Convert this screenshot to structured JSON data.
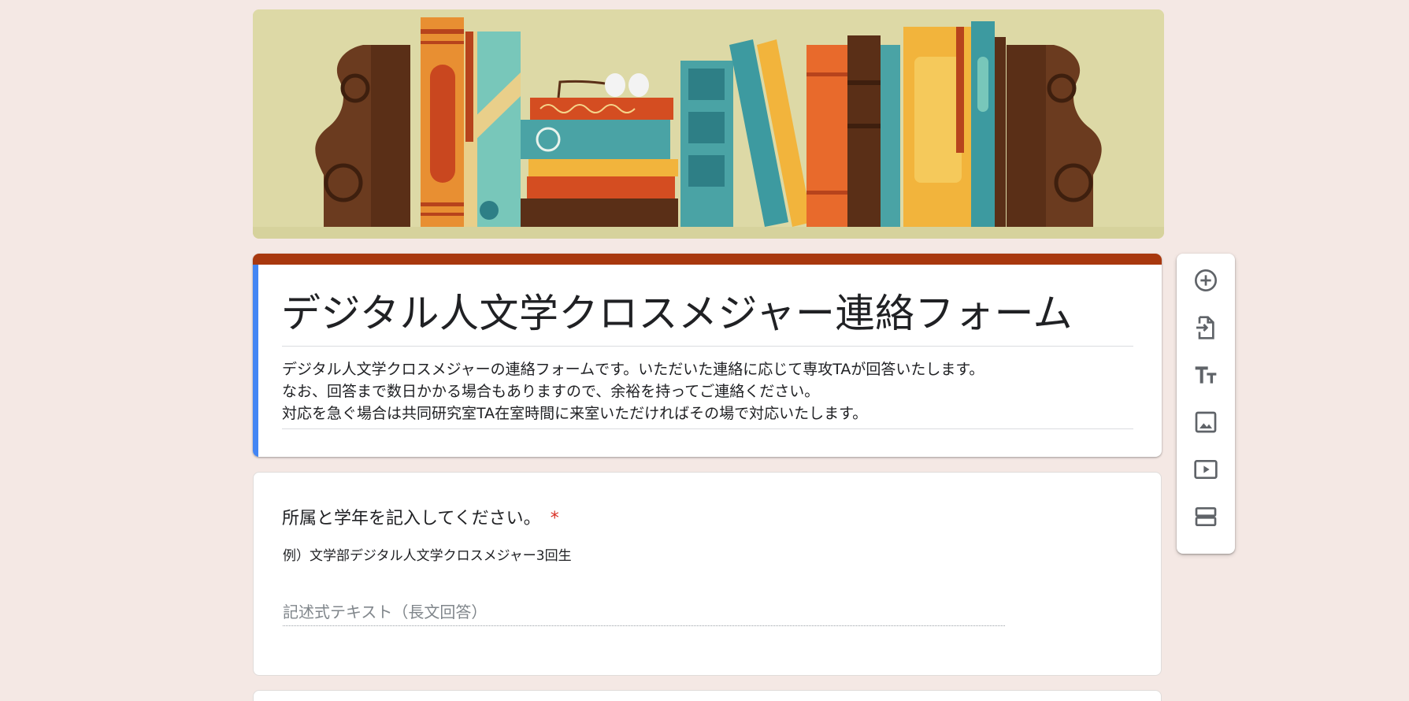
{
  "header": {
    "banner_image": "books-on-shelf-illustration"
  },
  "form": {
    "title": "デジタル人文学クロスメジャー連絡フォーム",
    "description_lines": [
      "デジタル人文学クロスメジャーの連絡フォームです。いただいた連絡に応じて専攻TAが回答いたします。",
      "なお、回答まで数日かかる場合もありますので、余裕を持ってご連絡ください。",
      "対応を急ぐ場合は共同研究室TA在室時間に来室いただければその場で対応いたします。"
    ],
    "accent_color": "#a8380e",
    "focus_color": "#4285f4"
  },
  "question1": {
    "title": "所属と学年を記入してください。",
    "required_mark": "*",
    "help_text": "例）文学部デジタル人文学クロスメジャー3回生",
    "placeholder": "記述式テキスト（長文回答）"
  },
  "toolbar": {
    "items": [
      {
        "name": "add-question",
        "icon": "plus-circle-icon"
      },
      {
        "name": "import-questions",
        "icon": "import-file-icon"
      },
      {
        "name": "add-title-description",
        "icon": "text-title-icon"
      },
      {
        "name": "add-image",
        "icon": "image-icon"
      },
      {
        "name": "add-video",
        "icon": "video-icon"
      },
      {
        "name": "add-section",
        "icon": "section-icon"
      }
    ]
  }
}
